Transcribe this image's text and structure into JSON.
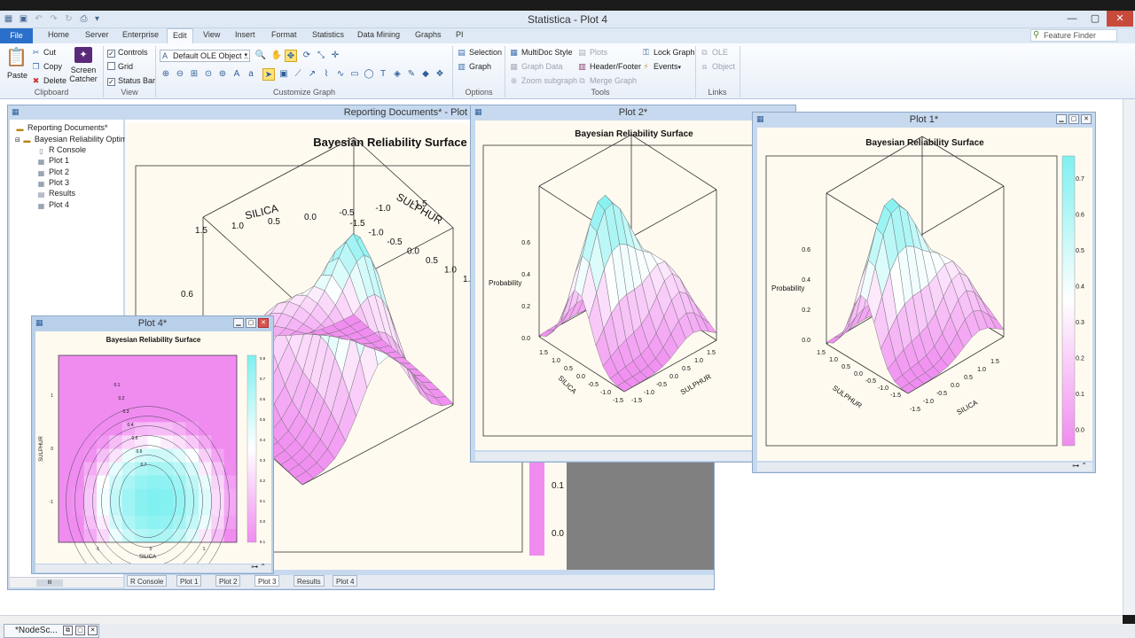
{
  "app": {
    "title": "Statistica - Plot 4"
  },
  "ribbon_tabs": [
    "File",
    "Home",
    "Server",
    "Enterprise",
    "Edit",
    "View",
    "Insert",
    "Format",
    "Statistics",
    "Data Mining",
    "Graphs",
    "PI"
  ],
  "active_tab": "Edit",
  "feature_finder": {
    "placeholder": "Feature Finder"
  },
  "ribbon": {
    "clipboard": {
      "label": "Clipboard",
      "paste": "Paste",
      "cut": "Cut",
      "copy": "Copy",
      "delete": "Delete",
      "screen_catcher": "Screen Catcher"
    },
    "view": {
      "label": "View",
      "controls": "Controls",
      "grid": "Grid",
      "status_bar": "Status Bar",
      "controls_checked": true,
      "grid_checked": false,
      "status_bar_checked": true
    },
    "customize": {
      "label": "Customize Graph",
      "ole_object": "Default OLE Object ..."
    },
    "options": {
      "label": "Options",
      "selection": "Selection",
      "graph": "Graph"
    },
    "tools": {
      "label": "Tools",
      "multidoc_style": "MultiDoc Style",
      "graph_data": "Graph Data",
      "zoom_subgraph": "Zoom subgraph",
      "plots": "Plots",
      "header_footer": "Header/Footer",
      "merge_graph": "Merge Graph",
      "lock_graph": "Lock Graph",
      "events": "Events"
    },
    "links": {
      "label": "Links",
      "ole": "OLE",
      "object": "Object"
    }
  },
  "workbook": {
    "title": "Reporting Documents* - Plot 3",
    "tree": {
      "root": "Reporting Documents*",
      "folder": "Bayesian Reliability Optim",
      "items": [
        "R Console",
        "Plot 1",
        "Plot 2",
        "Plot 3",
        "Results",
        "Plot 4"
      ]
    },
    "tabs": [
      "R Console",
      "Plot 1",
      "Plot 2",
      "Plot 3",
      "Results",
      "Plot 4"
    ],
    "active_doc_tab": "Plot 3"
  },
  "plot3": {
    "title": "Bayesian Reliability Surface",
    "x_axis": "SILICA",
    "y_axis": "SULPHUR",
    "silica_ticks": [
      "1.5",
      "1.0",
      "0.5",
      "0.0",
      "-0.5",
      "-1.0",
      "-1.5"
    ],
    "sulphur_ticks": [
      "-1.5",
      "-1.0",
      "-0.5",
      "0.0",
      "0.5",
      "1.0",
      "1.5"
    ],
    "z_tick": "0.6",
    "colorbar_ticks": [
      "0.1",
      "0.0"
    ]
  },
  "plot2": {
    "window_title": "Plot 2*",
    "title": "Bayesian Reliability Surface",
    "z_label": "Probability",
    "z_ticks": [
      "0.6",
      "0.4",
      "0.2",
      "0.0"
    ],
    "x_axis": "SILICA",
    "y_axis": "SULPHUR",
    "silica_ticks": [
      "-1.5",
      "-1.0",
      "-0.5",
      "0.0",
      "0.5",
      "1.0",
      "1.5"
    ],
    "sulphur_ticks": [
      "-1.5",
      "-1.0",
      "-0.5",
      "0.0",
      "0.5",
      "1.0",
      "1.5"
    ]
  },
  "plot1": {
    "window_title": "Plot 1*",
    "title": "Bayesian Reliability Surface",
    "z_label": "Probability",
    "z_ticks": [
      "0.6",
      "0.4",
      "0.2",
      "0.0"
    ],
    "x_axis": "SULPHUR",
    "y_axis": "SILICA",
    "sulphur_ticks": [
      "1.5",
      "1.0",
      "0.5",
      "0.0",
      "-0.5",
      "-1.0",
      "-1.5"
    ],
    "silica_ticks": [
      "-1.5",
      "-1.0",
      "-0.5",
      "0.0",
      "0.5",
      "1.0",
      "1.5"
    ],
    "colorbar_ticks": [
      "0.7",
      "0.6",
      "0.5",
      "0.4",
      "0.3",
      "0.2",
      "0.1",
      "0.0"
    ]
  },
  "plot4": {
    "window_title": "Plot 4*",
    "title": "Bayesian Reliability Surface",
    "x_axis": "SILICA",
    "y_axis": "SULPHUR",
    "x_ticks": [
      "-1",
      "0",
      "1"
    ],
    "y_ticks": [
      "1",
      "0",
      "-1"
    ],
    "contour_labels": [
      "0.1",
      "0.2",
      "0.3",
      "0.4",
      "0.5",
      "0.6",
      "0.7"
    ],
    "colorbar_ticks": [
      "0.8",
      "0.7",
      "0.6",
      "0.5",
      "0.4",
      "0.3",
      "0.2",
      "0.1",
      "0.0",
      "0.1"
    ]
  },
  "taskbar": {
    "item": "*NodeSc..."
  },
  "colors": {
    "cyan": "#7ff0f0",
    "magenta": "#f08cf0",
    "plot_bg": "#fffaf0",
    "accent": "#2a6fc9"
  }
}
